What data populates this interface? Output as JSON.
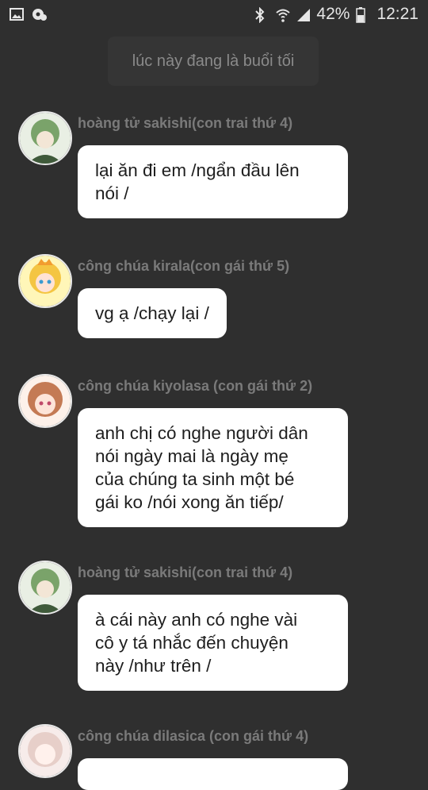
{
  "status_bar": {
    "left_icons": [
      "image-icon",
      "settings-notification-icon"
    ],
    "right_icons": [
      "bluetooth-icon",
      "wifi-icon",
      "signal-icon",
      "battery-icon"
    ],
    "battery": "42%",
    "time": "12:21"
  },
  "system_message": "lúc này đang là buổi tối",
  "messages": [
    {
      "sender": "hoàng tử sakishi(con trai thứ 4)",
      "text": "lại ăn đi em /ngẩn đầu lên\nnói /",
      "avatar_colors": [
        "#cfe3c2",
        "#6f9a59"
      ]
    },
    {
      "sender": "công chúa kirala(con gái thứ 5)",
      "text": "vg ạ /chạy lại /",
      "avatar_colors": [
        "#fff08a",
        "#f2b23b"
      ]
    },
    {
      "sender": "công chúa kiyolasa (con gái  thứ 2)",
      "text": "anh chị có nghe người dân\nnói ngày mai là ngày mẹ\ncủa chúng ta sinh một bé\ngái ko /nói xong ăn tiếp/",
      "avatar_colors": [
        "#fbe7d9",
        "#c9825b"
      ]
    },
    {
      "sender": "hoàng tử sakishi(con trai thứ 4)",
      "text": "à cái này anh có nghe vài\ncô y tá nhắc đến chuyện\nnày /như trên /",
      "avatar_colors": [
        "#cfe3c2",
        "#6f9a59"
      ]
    },
    {
      "sender": "công chúa dilasica (con gái thứ 4)",
      "text": "",
      "avatar_colors": [
        "#f7ecea",
        "#d9b7b0"
      ]
    }
  ]
}
